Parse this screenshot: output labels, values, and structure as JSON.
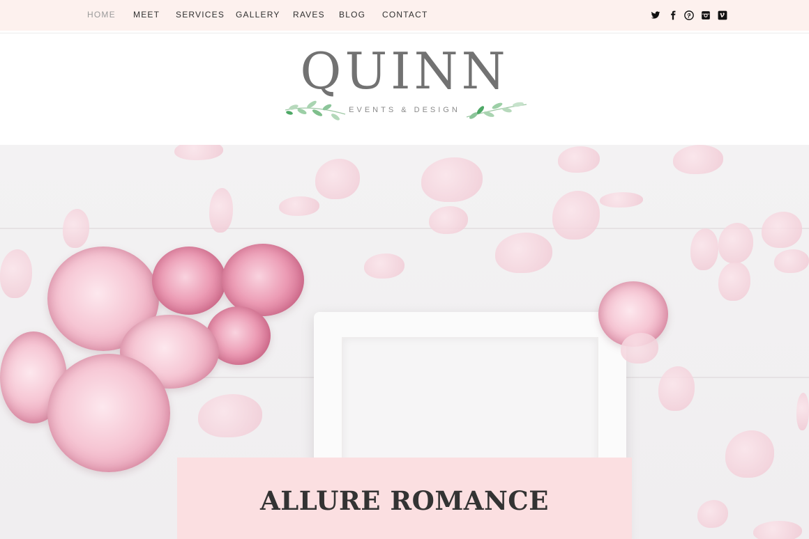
{
  "nav": {
    "items": [
      {
        "label": "HOME",
        "active": true
      },
      {
        "label": "MEET"
      },
      {
        "label": "SERVICES"
      },
      {
        "label": "GALLERY"
      },
      {
        "label": "RAVES"
      },
      {
        "label": "BLOG"
      },
      {
        "label": "CONTACT"
      }
    ]
  },
  "social": {
    "icons": [
      "twitter-icon",
      "facebook-icon",
      "pinterest-icon",
      "instagram-icon",
      "vimeo-icon"
    ]
  },
  "logo": {
    "name": "QUINN",
    "tagline": "EVENTS & DESIGN"
  },
  "hero": {
    "banner_title": "ALLURE ROMANCE"
  },
  "colors": {
    "topbar_bg": "#fdf1ee",
    "banner_bg": "#fbdfe1",
    "nav_active": "#9a9a9a",
    "nav_text": "#2f2f2f"
  }
}
